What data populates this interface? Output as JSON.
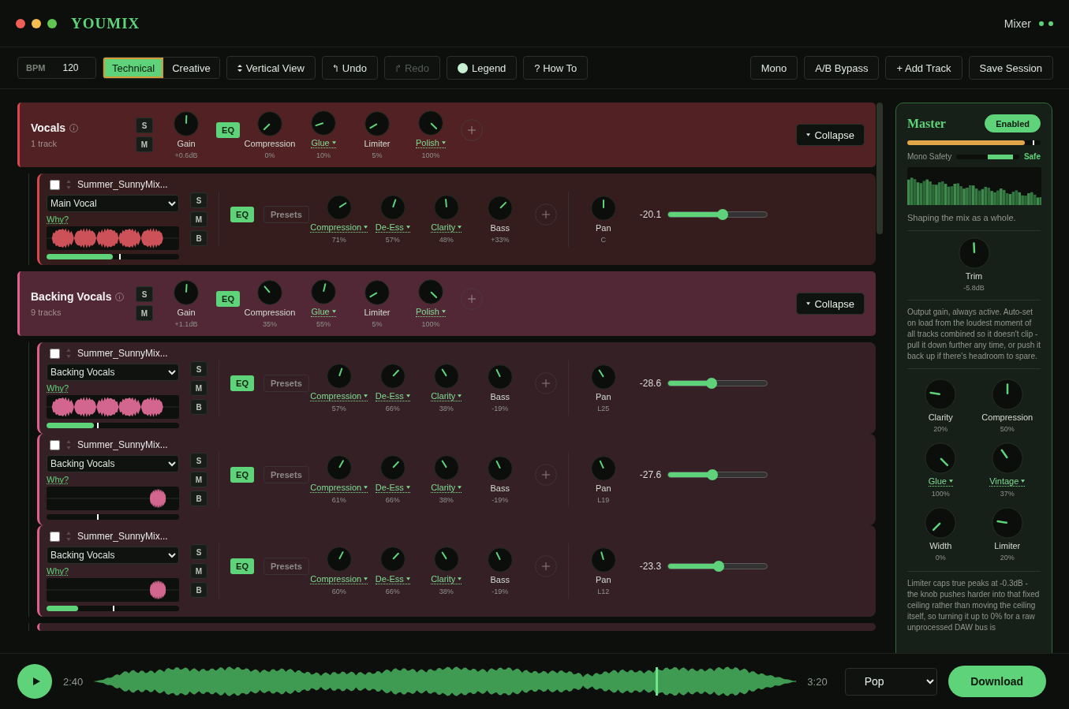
{
  "app": {
    "brand": "YOUMIX",
    "mode": "Mixer"
  },
  "toolbar": {
    "bpm": {
      "label": "BPM",
      "value": "120"
    },
    "modes": [
      {
        "label": "Technical",
        "selected": true
      },
      {
        "label": "Creative",
        "selected": false
      }
    ],
    "actions": [
      {
        "kind": "view",
        "label": "Vertical View",
        "disabled": false
      },
      {
        "kind": "undo",
        "label": "Undo",
        "disabled": false
      },
      {
        "kind": "redo",
        "label": "Redo",
        "disabled": true
      },
      {
        "kind": "legend",
        "label": "Legend",
        "disabled": false
      },
      {
        "kind": "help",
        "label": "? How To",
        "disabled": false
      }
    ],
    "right_actions": [
      "Mono",
      "A/B Bypass",
      "+ Add Track",
      "Save Session"
    ]
  },
  "groups": [
    {
      "name": "Vocals",
      "subtitle": "1 track",
      "color": "#d9474f",
      "solo": "S",
      "mute": "M",
      "eq": "EQ",
      "collapse": "Collapse",
      "gain": {
        "label": "Gain",
        "value": "+0.6dB",
        "dropdown": false
      },
      "knobs": [
        {
          "label": "Compression",
          "value": "0%",
          "dropdown": false
        },
        {
          "label": "Glue",
          "value": "10%",
          "dropdown": true
        },
        {
          "label": "Limiter",
          "value": "5%",
          "dropdown": false
        },
        {
          "label": "Polish",
          "value": "100%",
          "dropdown": true
        }
      ],
      "tracks": [
        {
          "name": "Summer_SunnyMix...",
          "checked": false,
          "role": "Main Vocal",
          "why": "Why?",
          "buttons": [
            "S",
            "M",
            "B"
          ],
          "eq": "EQ",
          "presets": "Presets",
          "waveform": {
            "kind": "full"
          },
          "meter": {
            "level": 0.5
          },
          "marker": {
            "level": 0.55
          },
          "knobs": [
            {
              "label": "Compression",
              "value": "71%",
              "dropdown": true
            },
            {
              "label": "De-Ess",
              "value": "57%",
              "dropdown": true
            },
            {
              "label": "Clarity",
              "value": "48%",
              "dropdown": true
            },
            {
              "label": "Bass",
              "value": "+33%",
              "dropdown": false
            }
          ],
          "pan": {
            "label": "Pan",
            "value": "C",
            "dropdown": false
          },
          "volume": {
            "reading": "-20.1",
            "level": 0.55
          }
        }
      ]
    },
    {
      "name": "Backing Vocals",
      "subtitle": "9 tracks",
      "color": "#e0608f",
      "solo": "S",
      "mute": "M",
      "eq": "EQ",
      "collapse": "Collapse",
      "gain": {
        "label": "Gain",
        "value": "+1.1dB",
        "dropdown": false
      },
      "knobs": [
        {
          "label": "Compression",
          "value": "35%",
          "dropdown": false
        },
        {
          "label": "Glue",
          "value": "55%",
          "dropdown": true
        },
        {
          "label": "Limiter",
          "value": "5%",
          "dropdown": false
        },
        {
          "label": "Polish",
          "value": "100%",
          "dropdown": true
        }
      ],
      "tracks": [
        {
          "name": "Summer_SunnyMix...",
          "checked": false,
          "role": "Backing Vocals",
          "why": "Why?",
          "buttons": [
            "S",
            "M",
            "B"
          ],
          "eq": "EQ",
          "presets": "Presets",
          "waveform": {
            "kind": "full"
          },
          "meter": {
            "level": 0.36
          },
          "marker": {
            "level": 0.38
          },
          "knobs": [
            {
              "label": "Compression",
              "value": "57%",
              "dropdown": true
            },
            {
              "label": "De-Ess",
              "value": "66%",
              "dropdown": true
            },
            {
              "label": "Clarity",
              "value": "38%",
              "dropdown": true
            },
            {
              "label": "Bass",
              "value": "-19%",
              "dropdown": false
            }
          ],
          "pan": {
            "label": "Pan",
            "value": "L25",
            "dropdown": false
          },
          "volume": {
            "reading": "-28.6",
            "level": 0.44
          }
        },
        {
          "name": "Summer_SunnyMix...",
          "checked": false,
          "role": "Backing Vocals",
          "why": "Why?",
          "buttons": [
            "S",
            "M",
            "B"
          ],
          "eq": "EQ",
          "presets": "Presets",
          "waveform": {
            "kind": "tail"
          },
          "marker": {
            "level": 0.38
          },
          "knobs": [
            {
              "label": "Compression",
              "value": "61%",
              "dropdown": true
            },
            {
              "label": "De-Ess",
              "value": "66%",
              "dropdown": true
            },
            {
              "label": "Clarity",
              "value": "38%",
              "dropdown": true
            },
            {
              "label": "Bass",
              "value": "-19%",
              "dropdown": false
            }
          ],
          "pan": {
            "label": "Pan",
            "value": "L19",
            "dropdown": false
          },
          "volume": {
            "reading": "-27.6",
            "level": 0.45
          }
        },
        {
          "name": "Summer_SunnyMix...",
          "checked": false,
          "role": "Backing Vocals",
          "why": "Why?",
          "buttons": [
            "S",
            "M",
            "B"
          ],
          "eq": "EQ",
          "presets": "Presets",
          "waveform": {
            "kind": "tail"
          },
          "meter": {
            "level": 0.24
          },
          "marker": {
            "level": 0.5
          },
          "knobs": [
            {
              "label": "Compression",
              "value": "60%",
              "dropdown": true
            },
            {
              "label": "De-Ess",
              "value": "66%",
              "dropdown": true
            },
            {
              "label": "Clarity",
              "value": "38%",
              "dropdown": true
            },
            {
              "label": "Bass",
              "value": "-19%",
              "dropdown": false
            }
          ],
          "pan": {
            "label": "Pan",
            "value": "L12",
            "dropdown": false
          },
          "volume": {
            "reading": "-23.3",
            "level": 0.51
          }
        }
      ]
    }
  ],
  "master": {
    "title": "Master",
    "enabled": {
      "label": "Enabled",
      "on": true
    },
    "loudness": {
      "level": 0.88
    },
    "ceiling": {
      "level": 0.94
    },
    "mono_safety": {
      "label": "Mono Safety",
      "reading": "Safe"
    },
    "caption": "Shaping the mix as a whole.",
    "trim": {
      "label": "Trim",
      "value": "-5.8dB",
      "dropdown": false
    },
    "trim_note": "Output gain, always active. Auto-set on load from the loudest moment of all tracks combined so it doesn't clip - pull it down further any time, or push it back up if there's headroom to spare.",
    "knobs": [
      {
        "label": "Clarity",
        "value": "20%",
        "dropdown": false
      },
      {
        "label": "Compression",
        "value": "50%",
        "dropdown": false
      },
      {
        "label": "Glue",
        "value": "100%",
        "dropdown": true
      },
      {
        "label": "Vintage",
        "value": "37%",
        "dropdown": true
      },
      {
        "label": "Width",
        "value": "0%",
        "dropdown": false
      },
      {
        "label": "Limiter",
        "value": "20%",
        "dropdown": false
      }
    ],
    "limiter_note": "Limiter caps true peaks at -0.3dB - the knob pushes harder into that fixed ceiling rather than moving the ceiling itself, so turning it up to 0% for a raw unprocessed DAW bus is"
  },
  "transport": {
    "elapsed": "2:40",
    "total": "3:20",
    "genre": "Pop",
    "download": "Download"
  }
}
